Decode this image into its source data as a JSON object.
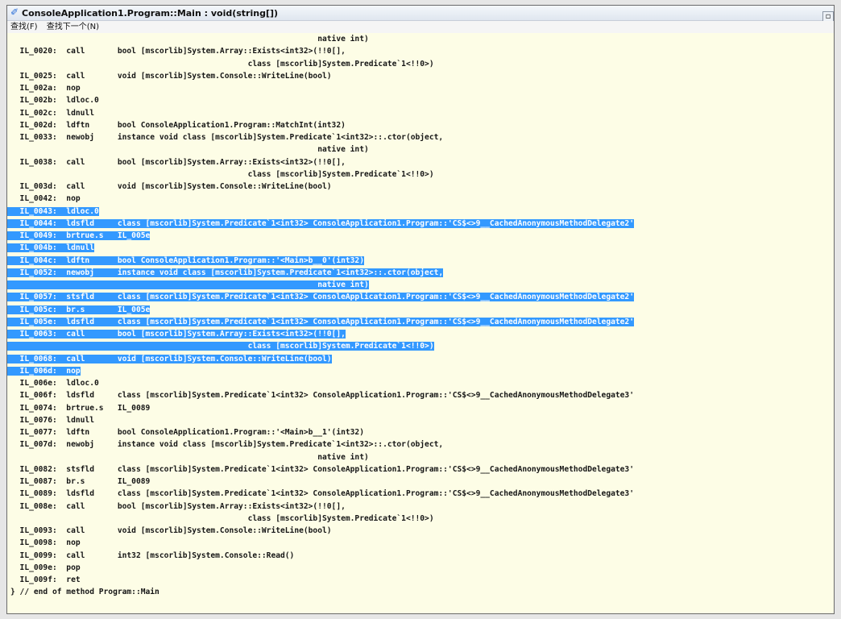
{
  "window": {
    "title": "ConsoleApplication1.Program::Main : void(string[])",
    "title_icon": "pen-icon"
  },
  "menu": {
    "items": [
      "查找(F)",
      "查找下一个(N)"
    ]
  },
  "colors": {
    "background": "#fdfde6",
    "selection": "#3399ff",
    "selection_text": "#ffffff"
  },
  "code": {
    "lines": [
      {
        "text": "                                                                  native int)",
        "selected": false
      },
      {
        "text": "  IL_0020:  call       bool [mscorlib]System.Array::Exists<int32>(!!0[],",
        "selected": false
      },
      {
        "text": "                                                   class [mscorlib]System.Predicate`1<!!0>)",
        "selected": false
      },
      {
        "text": "  IL_0025:  call       void [mscorlib]System.Console::WriteLine(bool)",
        "selected": false
      },
      {
        "text": "  IL_002a:  nop",
        "selected": false
      },
      {
        "text": "  IL_002b:  ldloc.0",
        "selected": false
      },
      {
        "text": "  IL_002c:  ldnull",
        "selected": false
      },
      {
        "text": "  IL_002d:  ldftn      bool ConsoleApplication1.Program::MatchInt(int32)",
        "selected": false
      },
      {
        "text": "  IL_0033:  newobj     instance void class [mscorlib]System.Predicate`1<int32>::.ctor(object,",
        "selected": false
      },
      {
        "text": "                                                                  native int)",
        "selected": false
      },
      {
        "text": "  IL_0038:  call       bool [mscorlib]System.Array::Exists<int32>(!!0[],",
        "selected": false
      },
      {
        "text": "                                                   class [mscorlib]System.Predicate`1<!!0>)",
        "selected": false
      },
      {
        "text": "  IL_003d:  call       void [mscorlib]System.Console::WriteLine(bool)",
        "selected": false
      },
      {
        "text": "  IL_0042:  nop",
        "selected": false
      },
      {
        "text": "  IL_0043:  ldloc.0",
        "selected": true
      },
      {
        "text": "  IL_0044:  ldsfld     class [mscorlib]System.Predicate`1<int32> ConsoleApplication1.Program::'CS$<>9__CachedAnonymousMethodDelegate2'",
        "selected": true
      },
      {
        "text": "  IL_0049:  brtrue.s   IL_005e",
        "selected": true
      },
      {
        "text": "  IL_004b:  ldnull",
        "selected": true
      },
      {
        "text": "  IL_004c:  ldftn      bool ConsoleApplication1.Program::'<Main>b__0'(int32)",
        "selected": true
      },
      {
        "text": "  IL_0052:  newobj     instance void class [mscorlib]System.Predicate`1<int32>::.ctor(object,",
        "selected": true
      },
      {
        "text": "                                                                  native int)",
        "selected": true
      },
      {
        "text": "  IL_0057:  stsfld     class [mscorlib]System.Predicate`1<int32> ConsoleApplication1.Program::'CS$<>9__CachedAnonymousMethodDelegate2'",
        "selected": true
      },
      {
        "text": "  IL_005c:  br.s       IL_005e",
        "selected": true
      },
      {
        "text": "  IL_005e:  ldsfld     class [mscorlib]System.Predicate`1<int32> ConsoleApplication1.Program::'CS$<>9__CachedAnonymousMethodDelegate2'",
        "selected": true
      },
      {
        "text": "  IL_0063:  call       bool [mscorlib]System.Array::Exists<int32>(!!0[],",
        "selected": true
      },
      {
        "text": "                                                   class [mscorlib]System.Predicate`1<!!0>)",
        "selected": true
      },
      {
        "text": "  IL_0068:  call       void [mscorlib]System.Console::WriteLine(bool)",
        "selected": true
      },
      {
        "text": "  IL_006d:  nop",
        "selected": true
      },
      {
        "text": "  IL_006e:  ldloc.0",
        "selected": false
      },
      {
        "text": "  IL_006f:  ldsfld     class [mscorlib]System.Predicate`1<int32> ConsoleApplication1.Program::'CS$<>9__CachedAnonymousMethodDelegate3'",
        "selected": false
      },
      {
        "text": "  IL_0074:  brtrue.s   IL_0089",
        "selected": false
      },
      {
        "text": "  IL_0076:  ldnull",
        "selected": false
      },
      {
        "text": "  IL_0077:  ldftn      bool ConsoleApplication1.Program::'<Main>b__1'(int32)",
        "selected": false
      },
      {
        "text": "  IL_007d:  newobj     instance void class [mscorlib]System.Predicate`1<int32>::.ctor(object,",
        "selected": false
      },
      {
        "text": "                                                                  native int)",
        "selected": false
      },
      {
        "text": "  IL_0082:  stsfld     class [mscorlib]System.Predicate`1<int32> ConsoleApplication1.Program::'CS$<>9__CachedAnonymousMethodDelegate3'",
        "selected": false
      },
      {
        "text": "  IL_0087:  br.s       IL_0089",
        "selected": false
      },
      {
        "text": "  IL_0089:  ldsfld     class [mscorlib]System.Predicate`1<int32> ConsoleApplication1.Program::'CS$<>9__CachedAnonymousMethodDelegate3'",
        "selected": false
      },
      {
        "text": "  IL_008e:  call       bool [mscorlib]System.Array::Exists<int32>(!!0[],",
        "selected": false
      },
      {
        "text": "                                                   class [mscorlib]System.Predicate`1<!!0>)",
        "selected": false
      },
      {
        "text": "  IL_0093:  call       void [mscorlib]System.Console::WriteLine(bool)",
        "selected": false
      },
      {
        "text": "  IL_0098:  nop",
        "selected": false
      },
      {
        "text": "  IL_0099:  call       int32 [mscorlib]System.Console::Read()",
        "selected": false
      },
      {
        "text": "  IL_009e:  pop",
        "selected": false
      },
      {
        "text": "  IL_009f:  ret",
        "selected": false
      },
      {
        "text": "} // end of method Program::Main",
        "selected": false
      }
    ]
  }
}
